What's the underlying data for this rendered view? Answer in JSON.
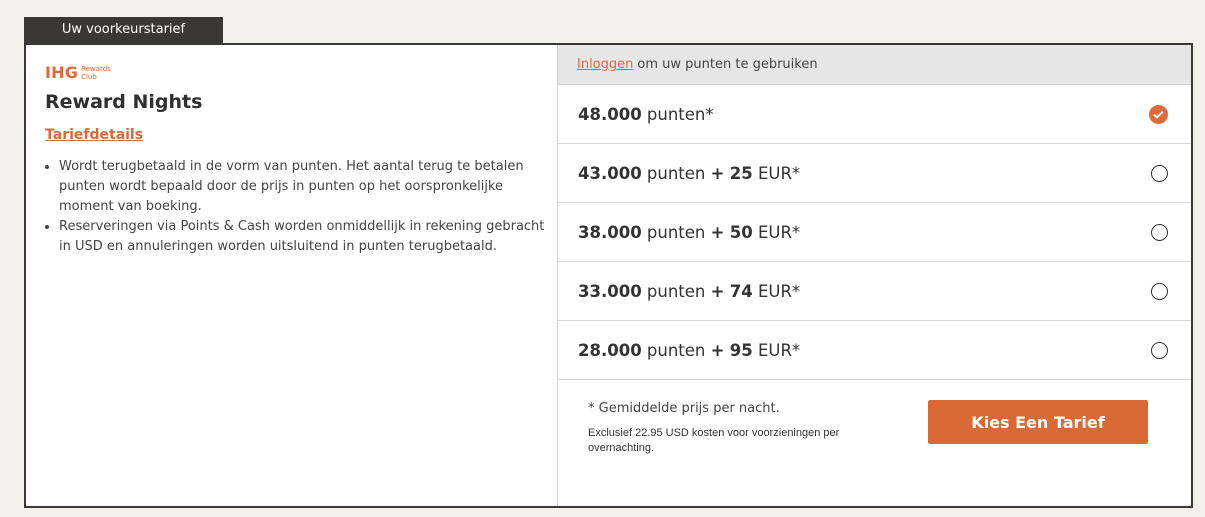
{
  "tab": {
    "label": "Uw voorkeurstarief"
  },
  "logo": {
    "mark": "IHG",
    "sub_line1": "Rewards",
    "sub_line2": "Club"
  },
  "left": {
    "title": "Reward Nights",
    "details_link": "Tariefdetails",
    "bullets": [
      "Wordt terugbetaald in de vorm van punten. Het aantal terug te betalen punten wordt bepaald door de prijs in punten op het oorspronkelijke moment van boeking.",
      "Reserveringen via Points & Cash worden onmiddellijk in rekening gebracht in USD en annuleringen worden uitsluitend in punten terugbetaald."
    ]
  },
  "login": {
    "link": "Inloggen",
    "text": "om uw punten te gebruiken"
  },
  "options": [
    {
      "points": "48.000",
      "points_label": "punten*",
      "cash_prefix": "",
      "cash_amount": "",
      "cash_suffix": "",
      "selected": true
    },
    {
      "points": "43.000",
      "points_label": "punten",
      "cash_prefix": "+",
      "cash_amount": "25",
      "cash_suffix": "EUR*",
      "selected": false
    },
    {
      "points": "38.000",
      "points_label": "punten",
      "cash_prefix": "+",
      "cash_amount": "50",
      "cash_suffix": "EUR*",
      "selected": false
    },
    {
      "points": "33.000",
      "points_label": "punten",
      "cash_prefix": "+",
      "cash_amount": "74",
      "cash_suffix": "EUR*",
      "selected": false
    },
    {
      "points": "28.000",
      "points_label": "punten",
      "cash_prefix": "+",
      "cash_amount": "95",
      "cash_suffix": "EUR*",
      "selected": false
    }
  ],
  "footer": {
    "note_avg": "*  Gemiddelde prijs per nacht.",
    "note_fees": "Exclusief 22.95 USD kosten voor voorzieningen per overnachting.",
    "cta_label": "Kies Een Tarief"
  },
  "colors": {
    "accent": "#d96a36",
    "dark": "#3a3836",
    "header_bg": "#e6e6e6"
  },
  "icons": {
    "selected": "check-circle-icon",
    "unselected": "radio-empty-icon"
  }
}
